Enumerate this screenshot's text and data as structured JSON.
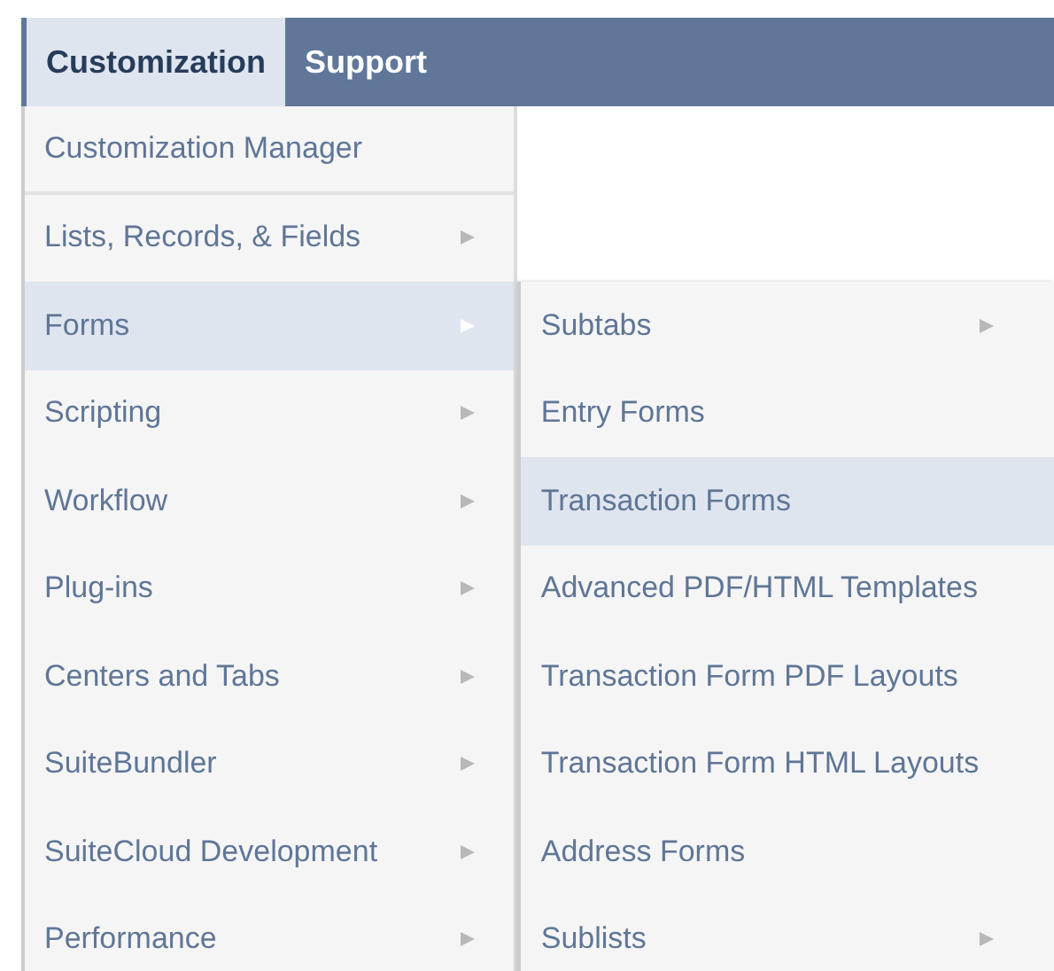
{
  "menubar": [
    {
      "label": "Customization",
      "selected": true
    },
    {
      "label": "Support",
      "selected": false
    }
  ],
  "menu": [
    {
      "label": "Customization Manager",
      "submenu": false,
      "selected": false,
      "divider": true
    },
    {
      "label": "Lists, Records, & Fields",
      "submenu": true,
      "selected": false,
      "divider": false
    },
    {
      "label": "Forms",
      "submenu": true,
      "selected": true,
      "divider": false
    },
    {
      "label": "Scripting",
      "submenu": true,
      "selected": false,
      "divider": false
    },
    {
      "label": "Workflow",
      "submenu": true,
      "selected": false,
      "divider": false
    },
    {
      "label": "Plug-ins",
      "submenu": true,
      "selected": false,
      "divider": false
    },
    {
      "label": "Centers and Tabs",
      "submenu": true,
      "selected": false,
      "divider": false
    },
    {
      "label": "SuiteBundler",
      "submenu": true,
      "selected": false,
      "divider": false
    },
    {
      "label": "SuiteCloud Development",
      "submenu": true,
      "selected": false,
      "divider": false
    },
    {
      "label": "Performance",
      "submenu": true,
      "selected": false,
      "divider": false
    }
  ],
  "submenu": [
    {
      "label": "Subtabs",
      "submenu": true,
      "selected": false
    },
    {
      "label": "Entry Forms",
      "submenu": false,
      "selected": false
    },
    {
      "label": "Transaction Forms",
      "submenu": false,
      "selected": true
    },
    {
      "label": "Advanced PDF/HTML Templates",
      "submenu": false,
      "selected": false
    },
    {
      "label": "Transaction Form PDF Layouts",
      "submenu": false,
      "selected": false
    },
    {
      "label": "Transaction Form HTML Layouts",
      "submenu": false,
      "selected": false
    },
    {
      "label": "Address Forms",
      "submenu": false,
      "selected": false
    },
    {
      "label": "Sublists",
      "submenu": true,
      "selected": false
    }
  ]
}
